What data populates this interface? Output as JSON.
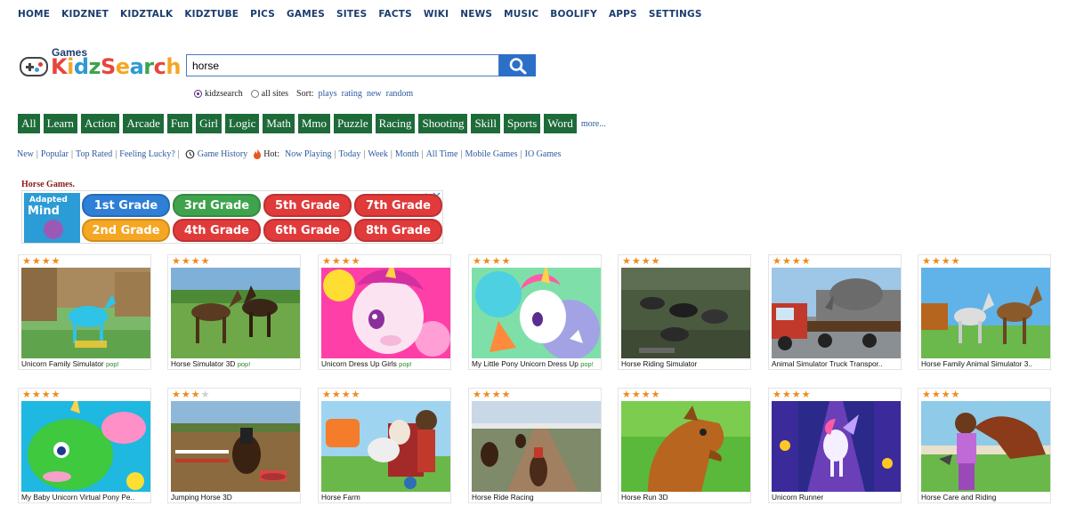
{
  "topnav": [
    "HOME",
    "KIDZNET",
    "KIDZTALK",
    "KIDZTUBE",
    "PICS",
    "GAMES",
    "SITES",
    "FACTS",
    "WIKI",
    "NEWS",
    "MUSIC",
    "BOOLIFY",
    "APPS",
    "SETTINGS"
  ],
  "logo": {
    "sub": "Games",
    "letters": [
      "K",
      "i",
      "d",
      "z",
      "S",
      "e",
      "a",
      "r",
      "c",
      "h"
    ]
  },
  "search": {
    "value": "horse",
    "button_icon": "search-icon"
  },
  "options": {
    "radio_kidzsearch": "kidzsearch",
    "radio_allsites": "all sites",
    "sort_label": "Sort:",
    "sort_links": [
      "plays",
      "rating",
      "new",
      "random"
    ]
  },
  "categories": [
    "All",
    "Learn",
    "Action",
    "Arcade",
    "Fun",
    "Girl",
    "Logic",
    "Math",
    "Mmo",
    "Puzzle",
    "Racing",
    "Shooting",
    "Skill",
    "Sports",
    "Word"
  ],
  "more_label": "more...",
  "filters": {
    "left": [
      "New",
      "Popular",
      "Top Rated",
      "Feeling Lucky?"
    ],
    "history": "Game History",
    "hot_label": "Hot:",
    "hot": [
      "Now Playing",
      "Today",
      "Week",
      "Month",
      "All Time",
      "Mobile Games",
      "IO Games"
    ]
  },
  "section_title": "Horse Games.",
  "ad": {
    "brand_line1": "Adapted",
    "brand_line2": "Mind",
    "grades": [
      {
        "label": "1st Grade",
        "color": "#2e7fd6"
      },
      {
        "label": "3rd Grade",
        "color": "#3fa34d"
      },
      {
        "label": "5th Grade",
        "color": "#e03a3a"
      },
      {
        "label": "7th Grade",
        "color": "#e03a3a"
      },
      {
        "label": "2nd Grade",
        "color": "#f5a623"
      },
      {
        "label": "4th Grade",
        "color": "#e03a3a"
      },
      {
        "label": "6th Grade",
        "color": "#e03a3a"
      },
      {
        "label": "8th Grade",
        "color": "#e03a3a"
      }
    ]
  },
  "games": [
    {
      "title": "Unicorn Family Simulator",
      "pop": "pop!",
      "stars": 4,
      "scene": "forest"
    },
    {
      "title": "Horse Simulator 3D",
      "pop": "pop!",
      "stars": 4,
      "scene": "field"
    },
    {
      "title": "Unicorn Dress Up Girls",
      "pop": "pop!",
      "stars": 4,
      "scene": "pink"
    },
    {
      "title": "My Little Pony Unicorn Dress Up",
      "pop": "pop!",
      "stars": 4,
      "scene": "rainbow"
    },
    {
      "title": "Horse Riding Simulator",
      "pop": "",
      "stars": 4,
      "scene": "dark"
    },
    {
      "title": "Animal Simulator Truck Transpor..",
      "pop": "",
      "stars": 4,
      "scene": "truck"
    },
    {
      "title": "Horse Family Animal Simulator 3..",
      "pop": "",
      "stars": 4,
      "scene": "sky"
    },
    {
      "title": "My Baby Unicorn Virtual Pony Pe..",
      "pop": "",
      "stars": 4,
      "scene": "slime"
    },
    {
      "title": "Jumping Horse 3D",
      "pop": "",
      "stars": 3.5,
      "scene": "jump"
    },
    {
      "title": "Horse Farm",
      "pop": "",
      "stars": 4,
      "scene": "farm"
    },
    {
      "title": "Horse Ride Racing",
      "pop": "",
      "stars": 4,
      "scene": "race"
    },
    {
      "title": "Horse Run 3D",
      "pop": "",
      "stars": 4,
      "scene": "run"
    },
    {
      "title": "Unicorn Runner",
      "pop": "",
      "stars": 4,
      "scene": "runner"
    },
    {
      "title": "Horse Care and Riding",
      "pop": "",
      "stars": 4,
      "scene": "care"
    }
  ],
  "colors": {
    "nav": "#1a3c6e",
    "category_bg": "#1e6b3a",
    "link": "#2c5aa0",
    "search_button": "#2c6fc7",
    "star": "#f08a1c"
  }
}
